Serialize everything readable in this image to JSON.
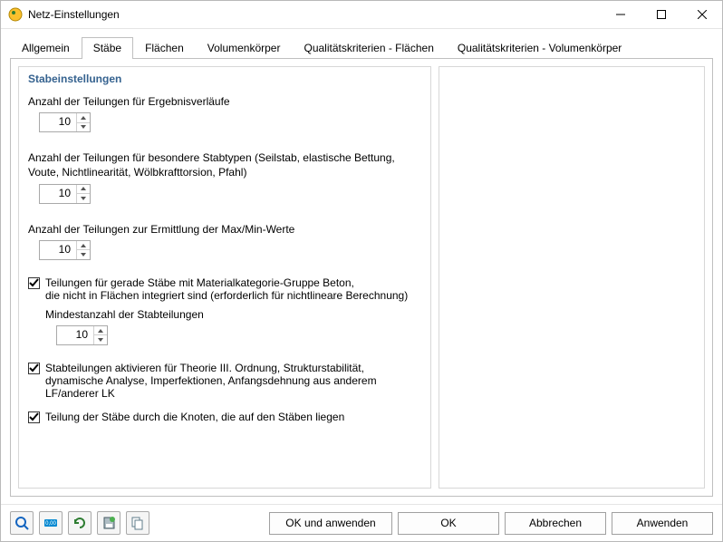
{
  "window": {
    "title": "Netz-Einstellungen"
  },
  "tabs": [
    {
      "label": "Allgemein",
      "active": false
    },
    {
      "label": "Stäbe",
      "active": true
    },
    {
      "label": "Flächen",
      "active": false
    },
    {
      "label": "Volumenkörper",
      "active": false
    },
    {
      "label": "Qualitätskriterien - Flächen",
      "active": false
    },
    {
      "label": "Qualitätskriterien - Volumenkörper",
      "active": false
    }
  ],
  "group": {
    "heading": "Stabeinstellungen"
  },
  "fields": {
    "divisions_results": {
      "label": "Anzahl der Teilungen für Ergebnisverläufe",
      "value": "10"
    },
    "divisions_special": {
      "label": "Anzahl der Teilungen für besondere Stabtypen (Seilstab, elastische Bettung, Voute, Nichtlinearität, Wölbkrafttorsion, Pfahl)",
      "value": "10"
    },
    "divisions_maxmin": {
      "label": "Anzahl der Teilungen zur Ermittlung der Max/Min-Werte",
      "value": "10"
    }
  },
  "checks": {
    "concrete": {
      "checked": true,
      "label": "Teilungen für gerade Stäbe mit Materialkategorie-Gruppe Beton,\ndie nicht in Flächen integriert sind (erforderlich für nichtlineare Berechnung)",
      "sub_label": "Mindestanzahl der Stabteilungen",
      "value": "10"
    },
    "theory3": {
      "checked": true,
      "label": "Stabteilungen aktivieren für Theorie III. Ordnung, Strukturstabilität,\ndynamische Analyse, Imperfektionen, Anfangsdehnung aus anderem LF/anderer LK"
    },
    "nodes_on_members": {
      "checked": true,
      "label": "Teilung der Stäbe durch die Knoten, die auf den Stäben liegen"
    }
  },
  "footer": {
    "ok_apply": "OK und anwenden",
    "ok": "OK",
    "cancel": "Abbrechen",
    "apply": "Anwenden"
  }
}
